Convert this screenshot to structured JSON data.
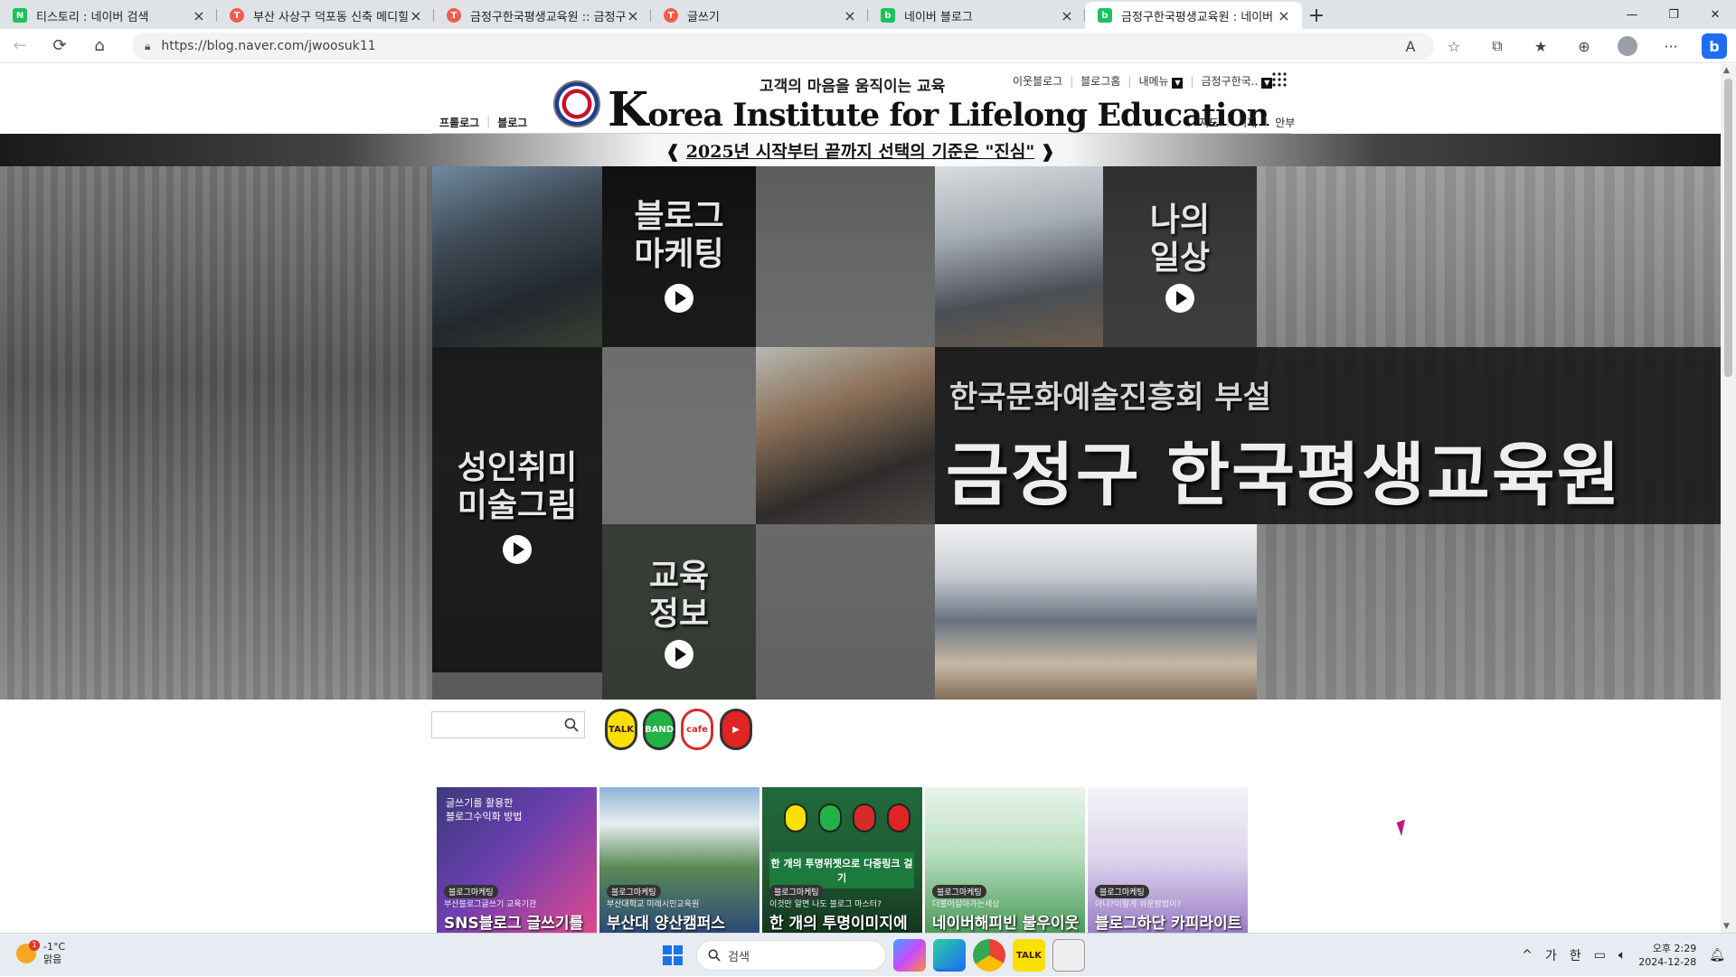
{
  "browser": {
    "tabs": [
      {
        "label": "티스토리 : 네이버 검색",
        "icon": "naver-icon",
        "fav": "N",
        "kind": "n"
      },
      {
        "label": "부산 사상구 덕포동 신축 메디힐",
        "icon": "tistory-icon",
        "fav": "T",
        "kind": "t"
      },
      {
        "label": "금정구한국평생교육원 :: 금정구",
        "icon": "tistory-icon",
        "fav": "T",
        "kind": "t"
      },
      {
        "label": "글쓰기",
        "icon": "tistory-icon",
        "fav": "T",
        "kind": "t"
      },
      {
        "label": "네이버 블로그",
        "icon": "blog-icon",
        "fav": "b",
        "kind": "b"
      },
      {
        "label": "금정구한국평생교육원 : 네이버",
        "icon": "blog-icon",
        "fav": "b",
        "kind": "b",
        "active": true
      }
    ],
    "new_tab": "+",
    "url": "https://blog.naver.com/jwoosuk11"
  },
  "blog": {
    "slogan": "고객의 마음을 움직이는 교육",
    "logo_text_k": "K",
    "logo_text_rest": "orea Institute for Lifelong Education",
    "top_nav": [
      "이웃블로그",
      "블로그홈",
      "내메뉴",
      "금정구한국.."
    ],
    "left_nav": [
      "프롤로그",
      "블로그"
    ],
    "right_nav": [
      "지도",
      "서재",
      "안부"
    ],
    "banner_prefix": "❰ ",
    "banner_underlined": "2025년 시작부터 끝까지 선택의 기준은 \"진심\"",
    "banner_suffix": " ❱"
  },
  "hero": {
    "tiles": {
      "blog_marketing": [
        "블로그",
        "마케팅"
      ],
      "my_daily": [
        "나의",
        "일상"
      ],
      "adult_hobby": [
        "성인취미",
        "미술그림"
      ],
      "edu_info": [
        "교육",
        "정보"
      ]
    },
    "title_sub": "한국문화예술진흥회 부설",
    "title_main": "금정구 한국평생교육원"
  },
  "widgets": {
    "search_placeholder": "",
    "sns": [
      {
        "name": "kakaotalk",
        "label": "TALK"
      },
      {
        "name": "band",
        "label": "BAND"
      },
      {
        "name": "cafe",
        "label": "cafe"
      },
      {
        "name": "youtube",
        "label": "▶"
      }
    ]
  },
  "cards": [
    {
      "top": "글쓰기를 활용한\n블로그수익화 방법",
      "cat": "블로그마케팅",
      "kicker": "부산블로그글쓰기 교육기관",
      "head": "SNS블로그 글쓰기를"
    },
    {
      "top": "",
      "cat": "블로그마케팅",
      "kicker": "부산대학교 미래시민교육원",
      "head": "부산대 양산캠퍼스"
    },
    {
      "top": "",
      "bar": "한 개의 투명위젯으로 다중링크 걸기",
      "cat": "블로그마케팅",
      "kicker": "이것만 알면 나도 블로그 마스터?",
      "head": "한 개의 투명이미지에"
    },
    {
      "top": "",
      "cat": "블로그마케팅",
      "kicker": "더불어살아가는세상",
      "head": "네이버해피빈 불우이웃"
    },
    {
      "top": "",
      "cat": "블로그마케팅",
      "kicker": "아니?이렇게 쉬운방법이?",
      "head": "블로그하단 카피라이트"
    }
  ],
  "taskbar": {
    "weather_temp": "-1°C",
    "weather_desc": "맑음",
    "weather_badge": "1",
    "search_label": "검색",
    "ime": [
      "가",
      "한"
    ],
    "time": "오후 2:29",
    "date": "2024-12-28",
    "tray_caret": "^"
  }
}
